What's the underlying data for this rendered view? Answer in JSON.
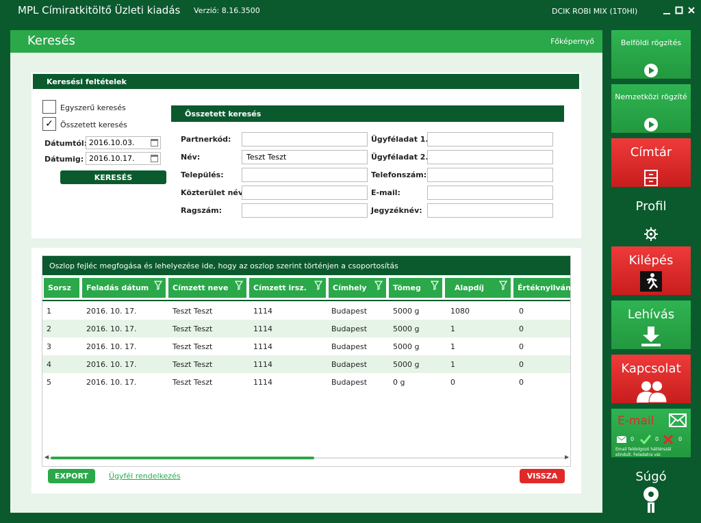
{
  "window": {
    "title": "MPL Címiratkitöltő Üzleti kiadás",
    "version": "Verzió: 8.16.3500",
    "user": "DCIK ROBI MIX (1T0HI)"
  },
  "page": {
    "title": "Keresés",
    "home_link": "Főképernyő"
  },
  "criteria": {
    "header": "Keresési feltételek",
    "simple_search": {
      "label": "Egyszerű keresés",
      "checked": false
    },
    "complex_search": {
      "label": "Összetett keresés",
      "checked": true
    },
    "date_from_label": "Dátumtól:",
    "date_from": "2016.10.03.",
    "date_to_label": "Dátumig:",
    "date_to": "2016.10.17.",
    "search_button": "KERESÉS"
  },
  "complex": {
    "header": "Összetett keresés",
    "fields": {
      "partner_code": {
        "label": "Partnerkód:",
        "value": ""
      },
      "name": {
        "label": "Név:",
        "value": "Teszt Teszt"
      },
      "city": {
        "label": "Település:",
        "value": ""
      },
      "street": {
        "label": "Közterület név:",
        "value": ""
      },
      "tag_number": {
        "label": "Ragszám:",
        "value": ""
      },
      "client_data1": {
        "label": "Ügyféladat 1.:",
        "value": ""
      },
      "client_data2": {
        "label": "Ügyféladat 2.:",
        "value": ""
      },
      "phone": {
        "label": "Telefonszám:",
        "value": ""
      },
      "email": {
        "label": "E-mail:",
        "value": ""
      },
      "list_name": {
        "label": "Jegyzéknév:",
        "value": ""
      }
    }
  },
  "grid": {
    "group_hint": "Oszlop fejléc megfogása és lehelyezése ide, hogy az oszlop szerint történjen a csoportosítás",
    "columns": [
      "Sorsz",
      "Feladás dátum",
      "Címzett neve",
      "Címzett irsz.",
      "Címhely",
      "Tömeg",
      "Alapdíj",
      "Értéknyilvání"
    ],
    "rows": [
      [
        "1",
        "2016. 10. 17.",
        "Teszt Teszt",
        "1114",
        "Budapest",
        "5000 g",
        "1080",
        "0"
      ],
      [
        "2",
        "2016. 10. 17.",
        "Teszt Teszt",
        "1114",
        "Budapest",
        "5000 g",
        "1",
        "0"
      ],
      [
        "3",
        "2016. 10. 17.",
        "Teszt Teszt",
        "1114",
        "Budapest",
        "5000 g",
        "1",
        "0"
      ],
      [
        "4",
        "2016. 10. 17.",
        "Teszt Teszt",
        "1114",
        "Budapest",
        "5000 g",
        "1",
        "0"
      ],
      [
        "5",
        "2016. 10. 17.",
        "Teszt Teszt",
        "1114",
        "Budapest",
        "0 g",
        "0",
        "0"
      ]
    ]
  },
  "actions": {
    "export": "EXPORT",
    "client_disposal": "Ügyfél rendelkezés",
    "back": "VISSZA"
  },
  "sidebar": {
    "domestic": "Belföldi rögzítés",
    "international": "Nemzetközi rögzíté",
    "directory": "Címtár",
    "profile": "Profil",
    "logout": "Kilépés",
    "download": "Lehívás",
    "contact": "Kapcsolat",
    "email": {
      "label": "E-mail",
      "count_mail": "0",
      "count_ok": "0",
      "count_error": "0",
      "note": "Email feldolgozó háttérszál elindult. Feladatra vár."
    },
    "help": "Súgó"
  },
  "colors": {
    "dark_green": "#0b5a2e",
    "green": "#2aa84a",
    "red": "#e02a2a",
    "background": "#e8f4ea"
  }
}
